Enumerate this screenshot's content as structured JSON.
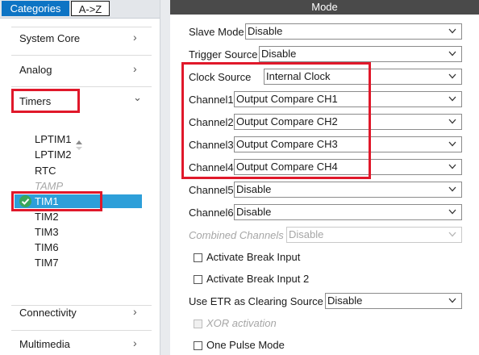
{
  "tabs": {
    "categories": "Categories",
    "atoz": "A->Z"
  },
  "categories": {
    "system_core": "System Core",
    "analog": "Analog",
    "timers": "Timers",
    "connectivity": "Connectivity",
    "multimedia": "Multimedia"
  },
  "timers_items": [
    "LPTIM1",
    "LPTIM2",
    "RTC",
    "TAMP",
    "TIM1",
    "TIM2",
    "TIM3",
    "TIM6",
    "TIM7"
  ],
  "selected_item": "TIM1",
  "mode": {
    "header": "Mode",
    "slave_mode": {
      "label": "Slave Mode",
      "value": "Disable"
    },
    "trigger_source": {
      "label": "Trigger Source",
      "value": "Disable"
    },
    "clock_source": {
      "label": "Clock Source",
      "value": "Internal Clock"
    },
    "channel1": {
      "label": "Channel1",
      "value": "Output Compare CH1"
    },
    "channel2": {
      "label": "Channel2",
      "value": "Output Compare CH2"
    },
    "channel3": {
      "label": "Channel3",
      "value": "Output Compare CH3"
    },
    "channel4": {
      "label": "Channel4",
      "value": "Output Compare CH4"
    },
    "channel5": {
      "label": "Channel5",
      "value": "Disable"
    },
    "channel6": {
      "label": "Channel6",
      "value": "Disable"
    },
    "combined_channels": {
      "label": "Combined Channels",
      "value": "Disable"
    },
    "activate_break_input": "Activate Break Input",
    "activate_break_input_2": "Activate Break Input 2",
    "use_etr": {
      "label": "Use ETR as Clearing Source",
      "value": "Disable"
    },
    "xor_activation": "XOR activation",
    "one_pulse_mode": "One Pulse Mode"
  },
  "colors": {
    "tab_active": "#0d74c4",
    "selected_row": "#2d9fd9",
    "highlight": "#e0182a",
    "header_bg": "#4a4a4a",
    "check_icon": "#3aa65a"
  }
}
